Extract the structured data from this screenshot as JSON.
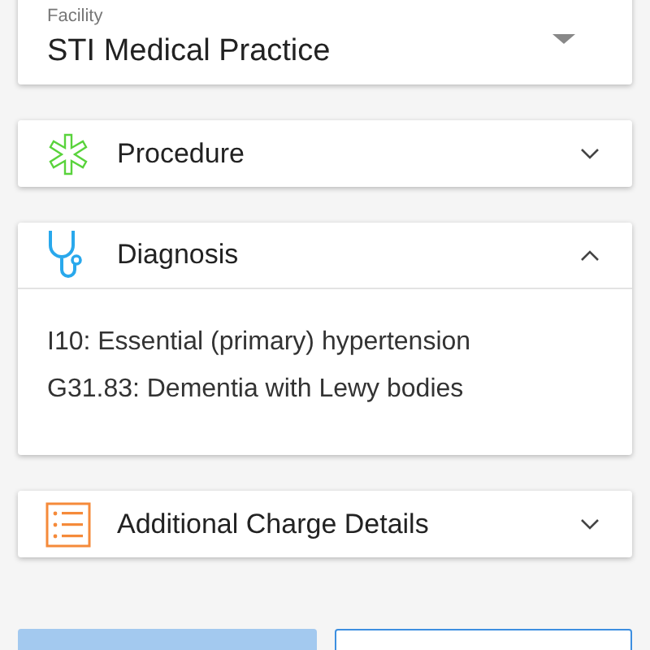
{
  "facility": {
    "label": "Facility",
    "value": "STI Medical Practice"
  },
  "sections": [
    {
      "kind": "procedure",
      "title": "Procedure",
      "expanded": false
    },
    {
      "kind": "diagnosis",
      "title": "Diagnosis",
      "expanded": true,
      "items": [
        "I10: Essential (primary) hypertension",
        "G31.83: Dementia with Lewy bodies"
      ]
    },
    {
      "kind": "details",
      "title": "Additional Charge Details",
      "expanded": false
    }
  ],
  "buttons": [
    {
      "kind": "primary"
    },
    {
      "kind": "secondary"
    }
  ]
}
